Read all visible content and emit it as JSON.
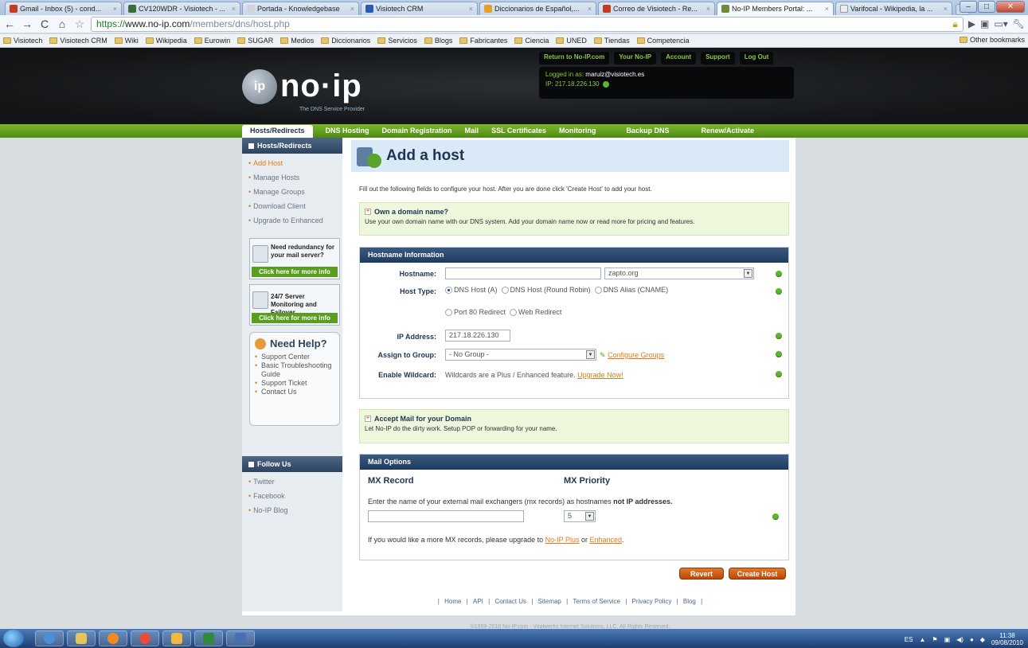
{
  "browser": {
    "tabs": [
      {
        "title": "Gmail - Inbox (5) - cond...",
        "color": "#c23b22"
      },
      {
        "title": "CV120WDR - Visiotech - ...",
        "color": "#3c6e3c"
      },
      {
        "title": "Portada - Knowledgebase",
        "color": "#d0d4da"
      },
      {
        "title": "Visiotech CRM",
        "color": "#2b5aa8"
      },
      {
        "title": "Diccionarios de Español,...",
        "color": "#e2a12a"
      },
      {
        "title": "Correo de Visiotech - Re...",
        "color": "#c23b22"
      },
      {
        "title": "No-IP Members Portal: ...",
        "color": "#6d8a3e"
      },
      {
        "title": "Varifocal - Wikipedia, la ...",
        "color": "#eeeeee"
      }
    ],
    "url_scheme": "https://",
    "url_host": "www.no-ip.com",
    "url_path": "/members/dns/host.php",
    "bookmarks": [
      "Visiotech",
      "Visiotech CRM",
      "Wiki",
      "Wikipedia",
      "Eurowin",
      "SUGAR",
      "Medios",
      "Diccionarios",
      "Servicios",
      "Blogs",
      "Fabricantes",
      "Ciencia",
      "UNED",
      "Tiendas",
      "Competencia"
    ],
    "other_bookmarks": "Other bookmarks"
  },
  "header": {
    "logo_text": "no·ip",
    "tagline": "The DNS Service Provider",
    "top_links": [
      "Return to No-IP.com",
      "Your No-IP",
      "Account",
      "Support",
      "Log Out"
    ],
    "logged_in_label": "Logged in as:",
    "logged_in_user": "maruiz@visiotech.es",
    "ip_label": "IP:",
    "ip_value": "217.18.226.130"
  },
  "mainnav": [
    "Hosts/Redirects",
    "DNS Hosting",
    "Domain Registration",
    "Mail",
    "SSL Certificates",
    "Monitoring",
    "Backup DNS",
    "Renew/Activate"
  ],
  "sidebar": {
    "title": "Hosts/Redirects",
    "items": [
      "Add Host",
      "Manage Hosts",
      "Manage Groups",
      "Download Client",
      "Upgrade to Enhanced"
    ],
    "promo1_text": "Need redundancy for your mail server?",
    "promo1_btn": "Click here for more info",
    "promo2_text": "24/7 Server Monitoring and Failover",
    "promo2_btn": "Click here for more info",
    "help_title": "Need Help?",
    "help_items": [
      "Support Center",
      "Basic Troubleshooting Guide",
      "Support Ticket",
      "Contact Us"
    ],
    "follow_title": "Follow Us",
    "follow_items": [
      "Twitter",
      "Facebook",
      "No-IP Blog"
    ]
  },
  "main": {
    "title": "Add a host",
    "intro": "Fill out the following fields to configure your host. After you are done click 'Create Host' to add your host.",
    "domain_box_title": "Own a domain name?",
    "domain_box_text": "Use your own domain name with our DNS system. Add your domain name now or read more for pricing and features.",
    "hostname_panel": "Hostname Information",
    "hostname_label": "Hostname:",
    "hostname_value": "",
    "domain_select": "zapto.org",
    "hosttype_label": "Host Type:",
    "hosttypes": [
      "DNS Host (A)",
      "DNS Host (Round Robin)",
      "DNS Alias (CNAME)",
      "Port 80 Redirect",
      "Web Redirect"
    ],
    "ip_label": "IP Address:",
    "ip_value": "217.18.226.130",
    "group_label": "Assign to Group:",
    "group_value": "- No Group -",
    "configure_groups": "Configure Groups",
    "wildcard_label": "Enable Wildcard:",
    "wildcard_text": "Wildcards are a Plus / Enhanced feature.",
    "upgrade_now": "Upgrade Now!",
    "mail_box_title": "Accept Mail for your Domain",
    "mail_box_text": "Let No-IP do the dirty work. Setup POP or forwarding for your name.",
    "mail_panel": "Mail Options",
    "mx_record": "MX Record",
    "mx_priority": "MX Priority",
    "mx_note_a": "Enter the name of your external mail exchangers (mx records) as hostnames ",
    "mx_note_b": "not IP addresses.",
    "mx_value": "",
    "mx_priority_value": "5",
    "upgrade_note_a": "If you would like a more MX records, please upgrade to ",
    "noip_plus": "No-IP Plus",
    "or": " or ",
    "enhanced": "Enhanced",
    "revert": "Revert",
    "create_host": "Create Host"
  },
  "footer": {
    "links": [
      "Home",
      "API",
      "Contact Us",
      "Sitemap",
      "Terms of Service",
      "Privacy Policy",
      "Blog"
    ],
    "copyright": "©1999-2010 No-IP.com - Vitalwerks Internet Solutions, LLC. All Rights Reserved."
  },
  "taskbar": {
    "lang": "ES",
    "time": "11:38",
    "date": "09/08/2010"
  }
}
